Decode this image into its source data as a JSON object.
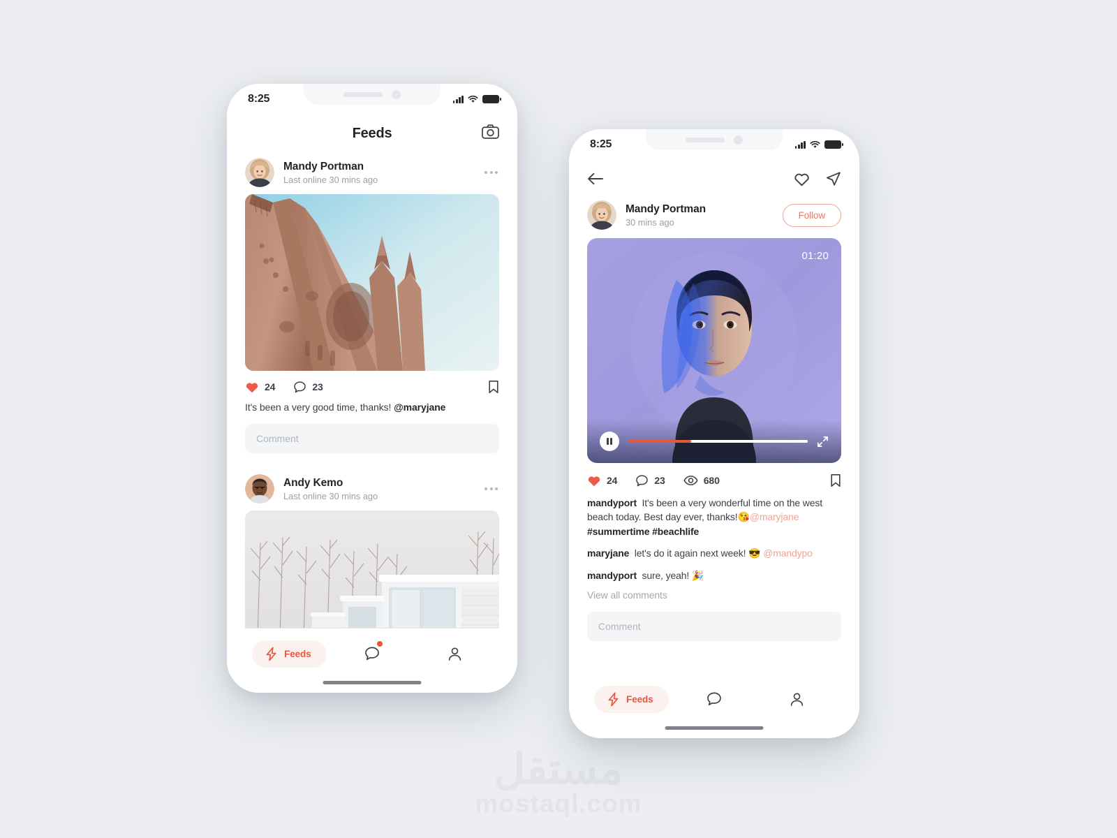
{
  "watermark": {
    "arabic": "مستقل",
    "latin": "mostaql.com"
  },
  "phone_left": {
    "status": {
      "time": "8:25",
      "signal_icon": "cellular-signal-icon",
      "wifi_icon": "wifi-icon",
      "battery_icon": "battery-icon"
    },
    "appbar": {
      "title": "Feeds",
      "camera_icon": "camera-icon"
    },
    "posts": [
      {
        "name": "Mandy Portman",
        "subtitle": "Last online 30 mins ago",
        "avatar": "avatar-mandy",
        "more_icon": "more-options-icon",
        "media": "photo-gothic-cathedral",
        "likes": "24",
        "comments": "23",
        "like_icon": "heart-filled-icon",
        "comment_icon": "comment-bubble-icon",
        "bookmark_icon": "bookmark-icon",
        "caption_text": "It's been a very good time, thanks! ",
        "caption_mention": "@maryjane",
        "comment_placeholder": "Comment"
      },
      {
        "name": "Andy Kemo",
        "subtitle": "Last online 30 mins ago",
        "avatar": "avatar-andy",
        "more_icon": "more-options-icon",
        "media": "photo-winter-house"
      }
    ],
    "nav": {
      "feeds_label": "Feeds",
      "feeds_icon": "lightning-bolt-icon",
      "messages_icon": "comment-bubble-icon",
      "profile_icon": "person-icon",
      "accent": "#e8563c",
      "badge": true
    }
  },
  "phone_right": {
    "status": {
      "time": "8:25",
      "signal_icon": "cellular-signal-icon",
      "wifi_icon": "wifi-icon",
      "battery_icon": "battery-icon"
    },
    "topbar": {
      "back_icon": "back-arrow-icon",
      "like_icon": "heart-outline-icon",
      "share_icon": "send-paper-plane-icon"
    },
    "user": {
      "name": "Mandy Portman",
      "subtitle": "30 mins ago",
      "avatar": "avatar-mandy",
      "follow_label": "Follow",
      "follow_color": "#ec7a5e"
    },
    "video": {
      "media": "video-portrait-woman-blue-light",
      "timer": "01:20",
      "play_icon": "pause-icon",
      "expand_icon": "fullscreen-expand-icon",
      "progress_percent": 35
    },
    "stats": {
      "likes": "24",
      "comments": "23",
      "views": "680",
      "like_icon": "heart-filled-icon",
      "comment_icon": "comment-bubble-icon",
      "views_icon": "eye-icon",
      "bookmark_icon": "bookmark-icon"
    },
    "thread": [
      {
        "user": "mandyport",
        "text": "It's been a very wonderful time on the west beach today. Best day ever, thanks!",
        "emoji": "😘",
        "mention": "@maryjane",
        "tail": "#summertime #beachlife"
      },
      {
        "user": "maryjane",
        "text": "let's do it again next week!",
        "emoji": "😎",
        "mention": "@mandypo",
        "tail": ""
      },
      {
        "user": "mandyport",
        "text": "sure, yeah!",
        "emoji": "🎉",
        "mention": "",
        "tail": ""
      }
    ],
    "view_all_label": "View all comments",
    "comment_placeholder": "Comment",
    "nav": {
      "feeds_label": "Feeds",
      "feeds_icon": "lightning-bolt-icon",
      "messages_icon": "comment-bubble-icon",
      "profile_icon": "person-icon",
      "accent": "#e8563c"
    }
  }
}
